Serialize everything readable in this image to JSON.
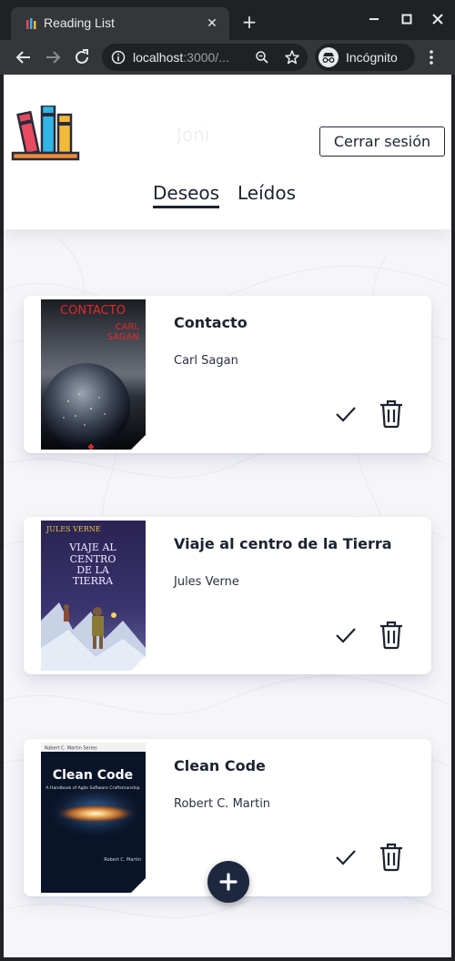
{
  "browser": {
    "tab_title": "Reading List",
    "tab_close": "✕",
    "new_tab": "+",
    "url_host": "localhost",
    "url_rest": ":3000/...",
    "incognito_label": "Incógnito"
  },
  "header": {
    "user_name": "Joni",
    "logout_label": "Cerrar sesión",
    "tabs": [
      {
        "label": "Deseos",
        "active": true
      },
      {
        "label": "Leídos",
        "active": false
      }
    ]
  },
  "books": [
    {
      "title": "Contacto",
      "author": "Carl Sagan",
      "cover": {
        "line1": "CONTACTO",
        "line2": "CARL",
        "line3": "SAGAN"
      }
    },
    {
      "title": "Viaje al centro de la Tierra",
      "author": "Jules Verne",
      "cover": {
        "author": "JULES VERNE",
        "line1": "VIAJE AL",
        "line2": "CENTRO",
        "line3": "DE LA",
        "line4": "TIERRA"
      }
    },
    {
      "title": "Clean Code",
      "author": "Robert C. Martin",
      "cover": {
        "top": "Robert C. Martin Series",
        "title": "Clean Code",
        "subtitle": "A Handbook of Agile Software Craftsmanship",
        "byline": "Robert C. Martin"
      }
    }
  ],
  "colors": {
    "accent": "#1d2840",
    "browser_dark": "#202124",
    "browser_toolbar": "#35363a"
  },
  "icons": [
    "info-icon",
    "zoom-icon",
    "star-icon",
    "incognito-icon",
    "check-icon",
    "trash-icon",
    "plus-icon"
  ]
}
